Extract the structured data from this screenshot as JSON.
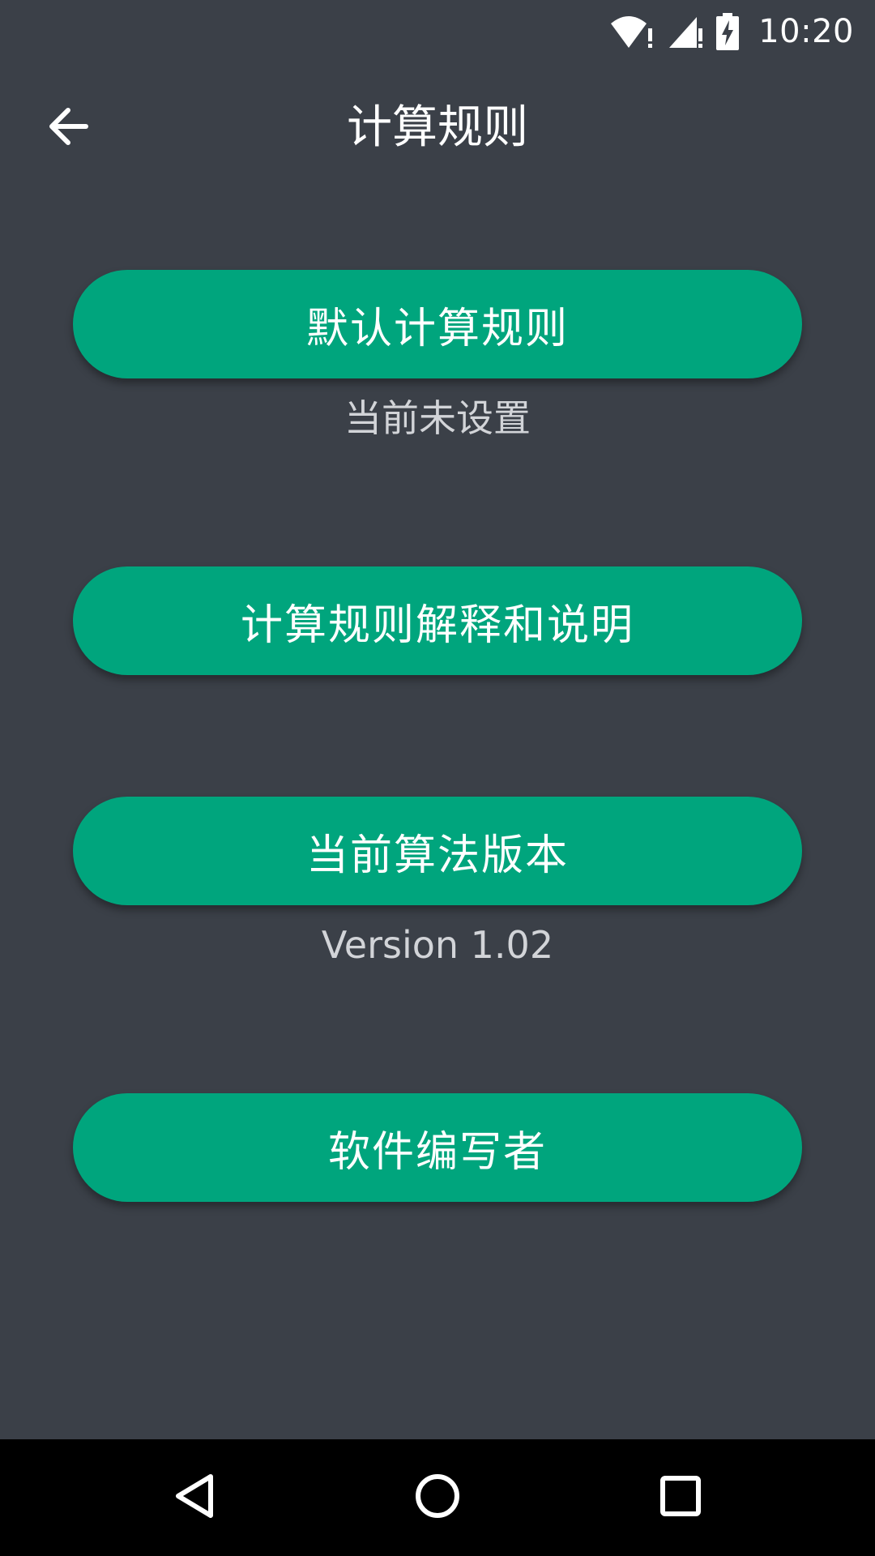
{
  "status_bar": {
    "time": "10:20",
    "icons": [
      "wifi-alert-icon",
      "signal-alert-icon",
      "battery-charging-icon"
    ]
  },
  "toolbar": {
    "title": "计算规则",
    "back_icon": "arrow-back-icon"
  },
  "buttons": {
    "default_rule": "默认计算规则",
    "rule_explanation": "计算规则解释和说明",
    "algorithm_version": "当前算法版本",
    "author": "软件编写者"
  },
  "captions": {
    "default_rule_status": "当前未设置",
    "version": "Version 1.02"
  },
  "nav_bar": {
    "icons": [
      "back-triangle-icon",
      "home-circle-icon",
      "recents-square-icon"
    ]
  },
  "colors": {
    "background": "#3b4048",
    "accent": "#00a57d",
    "caption_text": "#d2d4d8",
    "nav_background": "#000000"
  }
}
